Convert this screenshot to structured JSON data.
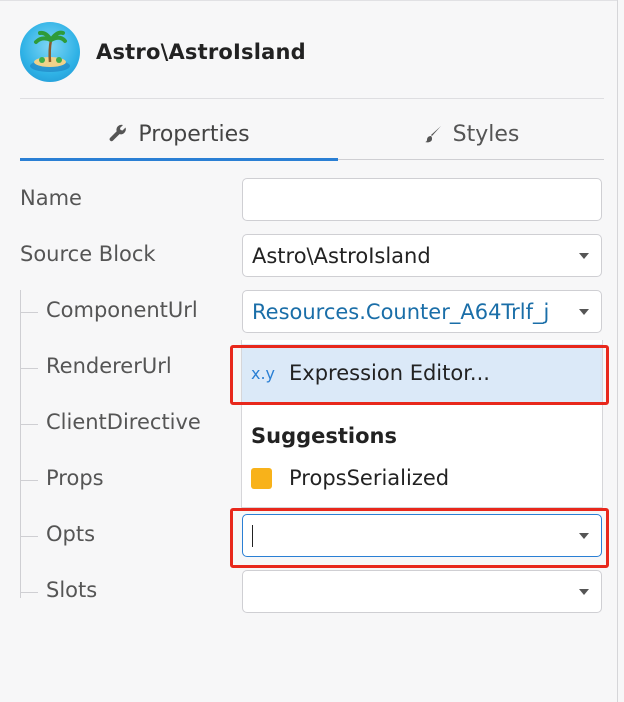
{
  "header": {
    "title": "Astro\\AstroIsland",
    "avatar_icon": "island-icon"
  },
  "tabs": [
    {
      "label": "Properties",
      "icon": "wrench-icon",
      "active": true
    },
    {
      "label": "Styles",
      "icon": "brush-icon",
      "active": false
    }
  ],
  "fields": {
    "name": {
      "label": "Name",
      "value": ""
    },
    "source_block": {
      "label": "Source Block",
      "value": "Astro\\AstroIsland"
    },
    "component_url": {
      "label": "ComponentUrl",
      "value": "Resources.Counter_A64Trlf_j"
    },
    "renderer_url": {
      "label": "RendererUrl"
    },
    "client_directive": {
      "label": "ClientDirective"
    },
    "props": {
      "label": "Props"
    },
    "opts": {
      "label": "Opts",
      "value": ""
    },
    "slots": {
      "label": "Slots",
      "value": ""
    }
  },
  "dropdown": {
    "expression_icon": "x.y",
    "expression_label": "Expression Editor...",
    "suggestions_heading": "Suggestions",
    "suggestions": [
      {
        "label": "PropsSerialized",
        "color": "#f8b21a"
      }
    ]
  },
  "colors": {
    "accent": "#2a7fd4",
    "highlight": "#e8281c",
    "link": "#1a6ea8"
  }
}
